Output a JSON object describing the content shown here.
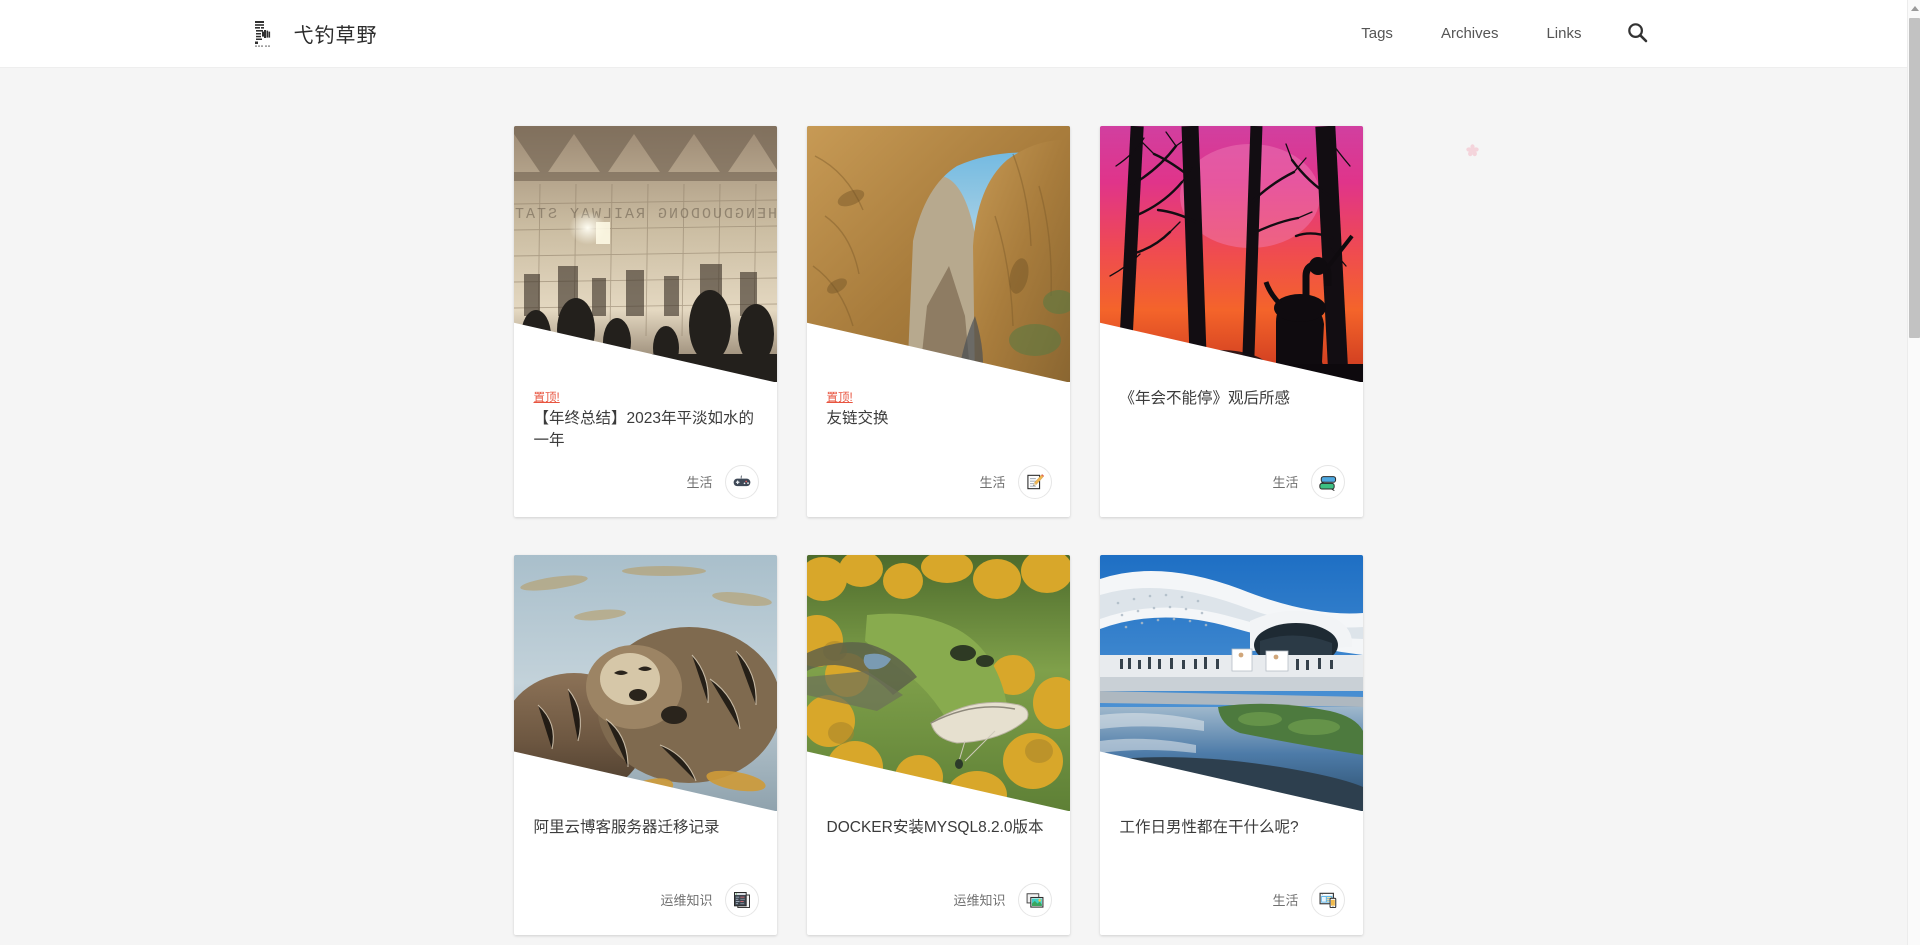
{
  "header": {
    "logo_icon": "seal-logo-icon",
    "site_title": "弋钓草野",
    "nav": [
      {
        "label": "Tags",
        "name": "nav-link-tags"
      },
      {
        "label": "Archives",
        "name": "nav-link-archives"
      },
      {
        "label": "Links",
        "name": "nav-link-links"
      }
    ],
    "search_icon": "search-icon"
  },
  "posts": [
    {
      "pinned_label": "置顶!",
      "title": "【年终总结】2023年平淡如水的一年",
      "tag": "生活",
      "tag_icon": "gamepad-icon",
      "thumb": "railway-station-sunset"
    },
    {
      "pinned_label": "置顶!",
      "title": "友链交换",
      "tag": "生活",
      "tag_icon": "memo-pencil-icon",
      "thumb": "sandstone-arch-canyon"
    },
    {
      "pinned_label": "",
      "title": "《年会不能停》观后所感",
      "tag": "生活",
      "tag_icon": "speech-bubbles-icon",
      "thumb": "sunset-horse-rider-silhouette"
    },
    {
      "pinned_label": "",
      "title": "阿里云博客服务器迁移记录",
      "tag": "运维知识",
      "tag_icon": "code-window-stack-icon",
      "thumb": "sea-otters-sleeping"
    },
    {
      "pinned_label": "",
      "title": "DOCKER安装MYSQL8.2.0版本",
      "tag": "运维知识",
      "tag_icon": "photo-stack-icon",
      "thumb": "autumn-meadow-paraglider"
    },
    {
      "pinned_label": "",
      "title": "工作日男性都在干什么呢?",
      "tag": "生活",
      "tag_icon": "devices-icon",
      "thumb": "modern-museum-waterfront"
    }
  ],
  "decoration": {
    "petal_icon": "sakura-petal-icon",
    "petal_color": "#f4d4db"
  },
  "colors": {
    "page_background": "#f5f5f5",
    "header_background": "#ffffff",
    "card_background": "#ffffff",
    "pin_badge": "#e8543f",
    "title_text": "#3b3b3b",
    "tag_text": "#707070",
    "nav_text": "#555555"
  }
}
